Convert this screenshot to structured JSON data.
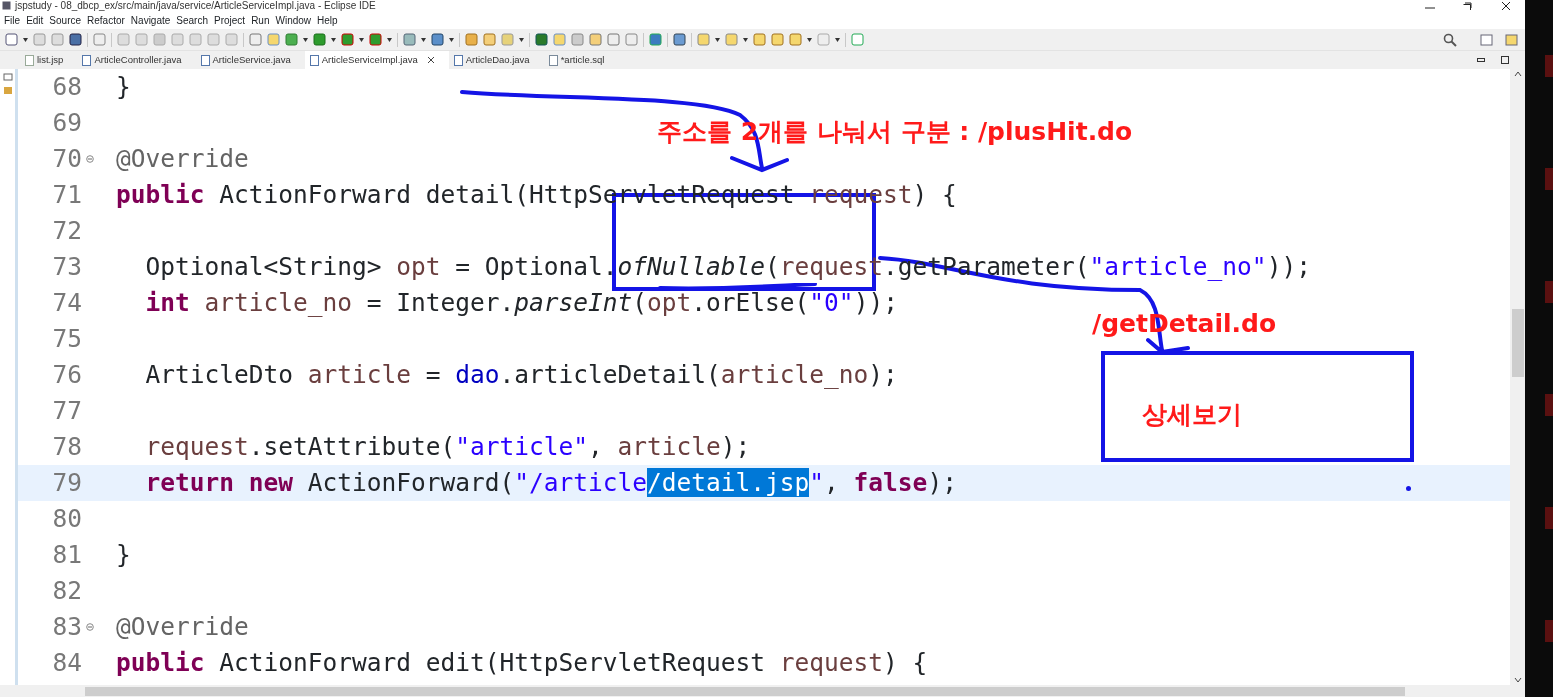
{
  "window": {
    "title": "jspstudy - 08_dbcp_ex/src/main/java/service/ArticleServiceImpl.java - Eclipse IDE"
  },
  "menu": [
    "File",
    "Edit",
    "Source",
    "Refactor",
    "Navigate",
    "Search",
    "Project",
    "Run",
    "Window",
    "Help"
  ],
  "tabs": [
    {
      "label": "list.jsp",
      "kind": "jsp",
      "selected": false
    },
    {
      "label": "ArticleController.java",
      "kind": "java",
      "selected": false
    },
    {
      "label": "ArticleService.java",
      "kind": "java",
      "selected": false
    },
    {
      "label": "ArticleServiceImpl.java",
      "kind": "java",
      "selected": true
    },
    {
      "label": "ArticleDao.java",
      "kind": "java",
      "selected": false
    },
    {
      "label": "*article.sql",
      "kind": "sql",
      "selected": false
    }
  ],
  "editor": {
    "lines": [
      {
        "number": "68",
        "fold": false,
        "current": false,
        "indented": false,
        "tokens": [
          {
            "kind": "plain",
            "text": "}"
          }
        ]
      },
      {
        "number": "69",
        "fold": false,
        "current": false
      },
      {
        "number": "70",
        "fold": true,
        "current": false,
        "indented": false,
        "tokens": [
          {
            "kind": "annotation",
            "text": "@Override"
          }
        ]
      },
      {
        "number": "71",
        "fold": false,
        "current": false,
        "indented": false,
        "tokens": [
          {
            "kind": "keyword",
            "text": "public"
          },
          {
            "kind": "plain",
            "text": " ActionForward detail(HttpServletRequest "
          },
          {
            "kind": "local",
            "text": "request"
          },
          {
            "kind": "plain",
            "text": ") {"
          }
        ]
      },
      {
        "number": "72",
        "fold": false,
        "current": false
      },
      {
        "number": "73",
        "fold": false,
        "current": false,
        "indented": true,
        "tokens": [
          {
            "kind": "plain",
            "text": "Optional<String> "
          },
          {
            "kind": "local",
            "text": "opt"
          },
          {
            "kind": "plain",
            "text": " = Optional."
          },
          {
            "kind": "static",
            "text": "ofNullable"
          },
          {
            "kind": "plain",
            "text": "("
          },
          {
            "kind": "local",
            "text": "request"
          },
          {
            "kind": "plain",
            "text": ".getParameter("
          },
          {
            "kind": "string",
            "text": "\"article_no\""
          },
          {
            "kind": "plain",
            "text": "));"
          }
        ]
      },
      {
        "number": "74",
        "fold": false,
        "current": false,
        "indented": true,
        "tokens": [
          {
            "kind": "keyword",
            "text": "int"
          },
          {
            "kind": "local",
            "text": " article_no"
          },
          {
            "kind": "plain",
            "text": " = Integer."
          },
          {
            "kind": "static",
            "text": "parseInt"
          },
          {
            "kind": "plain",
            "text": "("
          },
          {
            "kind": "local",
            "text": "opt"
          },
          {
            "kind": "plain",
            "text": ".orElse("
          },
          {
            "kind": "string",
            "text": "\"0\""
          },
          {
            "kind": "plain",
            "text": "));"
          }
        ]
      },
      {
        "number": "75",
        "fold": false,
        "current": false
      },
      {
        "number": "76",
        "fold": false,
        "current": false,
        "indented": true,
        "tokens": [
          {
            "kind": "plain",
            "text": "ArticleDto "
          },
          {
            "kind": "local",
            "text": "article"
          },
          {
            "kind": "plain",
            "text": " = "
          },
          {
            "kind": "field",
            "text": "dao"
          },
          {
            "kind": "plain",
            "text": ".articleDetail("
          },
          {
            "kind": "local",
            "text": "article_no"
          },
          {
            "kind": "plain",
            "text": ");"
          }
        ]
      },
      {
        "number": "77",
        "fold": false,
        "current": false
      },
      {
        "number": "78",
        "fold": false,
        "current": false,
        "indented": true,
        "tokens": [
          {
            "kind": "local",
            "text": "request"
          },
          {
            "kind": "plain",
            "text": ".setAttribute("
          },
          {
            "kind": "string",
            "text": "\"article\""
          },
          {
            "kind": "plain",
            "text": ", "
          },
          {
            "kind": "local",
            "text": "article"
          },
          {
            "kind": "plain",
            "text": ");"
          }
        ]
      },
      {
        "number": "79",
        "fold": false,
        "current": true,
        "indented": true,
        "tokens": [
          {
            "kind": "keyword",
            "text": "return"
          },
          {
            "kind": "keyword",
            "text": " new"
          },
          {
            "kind": "plain",
            "text": " ActionForward("
          },
          {
            "kind": "string",
            "text": "\"/article"
          },
          {
            "kind": "selection",
            "text": "/detail.jsp"
          },
          {
            "kind": "string",
            "text": "\""
          },
          {
            "kind": "plain",
            "text": ", "
          },
          {
            "kind": "keyword",
            "text": "false"
          },
          {
            "kind": "plain",
            "text": ");"
          }
        ]
      },
      {
        "number": "80",
        "fold": false,
        "current": false
      },
      {
        "number": "81",
        "fold": false,
        "current": false,
        "indented": false,
        "tokens": [
          {
            "kind": "plain",
            "text": "}"
          }
        ]
      },
      {
        "number": "82",
        "fold": false,
        "current": false
      },
      {
        "number": "83",
        "fold": true,
        "current": false,
        "indented": false,
        "tokens": [
          {
            "kind": "annotation",
            "text": "@Override"
          }
        ]
      },
      {
        "number": "84",
        "fold": false,
        "current": false,
        "indented": false,
        "tokens": [
          {
            "kind": "keyword",
            "text": "public"
          },
          {
            "kind": "plain",
            "text": " ActionForward edit(HttpServletRequest "
          },
          {
            "kind": "local",
            "text": "request"
          },
          {
            "kind": "plain",
            "text": ") {"
          }
        ]
      }
    ]
  },
  "annotations": {
    "note_top": "주소를 2개를 나눠서 구분 : /plusHit.do",
    "note_right": "/getDetail.do",
    "box_label": "상세보기"
  }
}
